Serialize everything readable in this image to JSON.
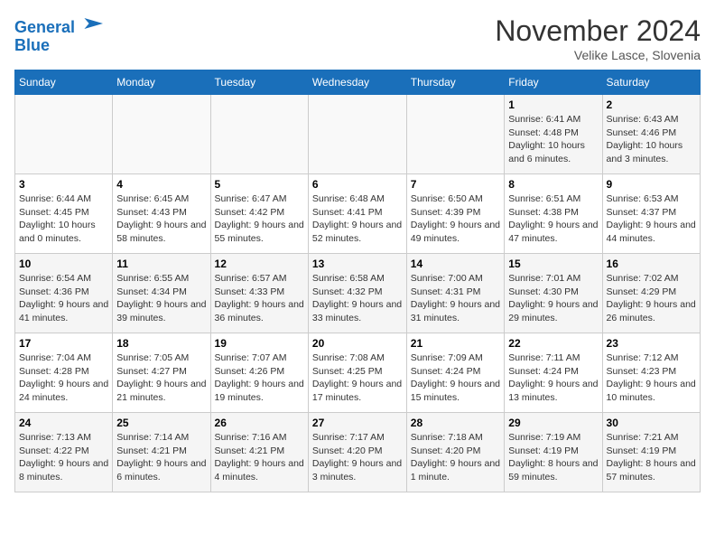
{
  "header": {
    "logo_line1": "General",
    "logo_line2": "Blue",
    "month_title": "November 2024",
    "location": "Velike Lasce, Slovenia"
  },
  "days_of_week": [
    "Sunday",
    "Monday",
    "Tuesday",
    "Wednesday",
    "Thursday",
    "Friday",
    "Saturday"
  ],
  "weeks": [
    [
      {
        "day": "",
        "info": ""
      },
      {
        "day": "",
        "info": ""
      },
      {
        "day": "",
        "info": ""
      },
      {
        "day": "",
        "info": ""
      },
      {
        "day": "",
        "info": ""
      },
      {
        "day": "1",
        "info": "Sunrise: 6:41 AM\nSunset: 4:48 PM\nDaylight: 10 hours and 6 minutes."
      },
      {
        "day": "2",
        "info": "Sunrise: 6:43 AM\nSunset: 4:46 PM\nDaylight: 10 hours and 3 minutes."
      }
    ],
    [
      {
        "day": "3",
        "info": "Sunrise: 6:44 AM\nSunset: 4:45 PM\nDaylight: 10 hours and 0 minutes."
      },
      {
        "day": "4",
        "info": "Sunrise: 6:45 AM\nSunset: 4:43 PM\nDaylight: 9 hours and 58 minutes."
      },
      {
        "day": "5",
        "info": "Sunrise: 6:47 AM\nSunset: 4:42 PM\nDaylight: 9 hours and 55 minutes."
      },
      {
        "day": "6",
        "info": "Sunrise: 6:48 AM\nSunset: 4:41 PM\nDaylight: 9 hours and 52 minutes."
      },
      {
        "day": "7",
        "info": "Sunrise: 6:50 AM\nSunset: 4:39 PM\nDaylight: 9 hours and 49 minutes."
      },
      {
        "day": "8",
        "info": "Sunrise: 6:51 AM\nSunset: 4:38 PM\nDaylight: 9 hours and 47 minutes."
      },
      {
        "day": "9",
        "info": "Sunrise: 6:53 AM\nSunset: 4:37 PM\nDaylight: 9 hours and 44 minutes."
      }
    ],
    [
      {
        "day": "10",
        "info": "Sunrise: 6:54 AM\nSunset: 4:36 PM\nDaylight: 9 hours and 41 minutes."
      },
      {
        "day": "11",
        "info": "Sunrise: 6:55 AM\nSunset: 4:34 PM\nDaylight: 9 hours and 39 minutes."
      },
      {
        "day": "12",
        "info": "Sunrise: 6:57 AM\nSunset: 4:33 PM\nDaylight: 9 hours and 36 minutes."
      },
      {
        "day": "13",
        "info": "Sunrise: 6:58 AM\nSunset: 4:32 PM\nDaylight: 9 hours and 33 minutes."
      },
      {
        "day": "14",
        "info": "Sunrise: 7:00 AM\nSunset: 4:31 PM\nDaylight: 9 hours and 31 minutes."
      },
      {
        "day": "15",
        "info": "Sunrise: 7:01 AM\nSunset: 4:30 PM\nDaylight: 9 hours and 29 minutes."
      },
      {
        "day": "16",
        "info": "Sunrise: 7:02 AM\nSunset: 4:29 PM\nDaylight: 9 hours and 26 minutes."
      }
    ],
    [
      {
        "day": "17",
        "info": "Sunrise: 7:04 AM\nSunset: 4:28 PM\nDaylight: 9 hours and 24 minutes."
      },
      {
        "day": "18",
        "info": "Sunrise: 7:05 AM\nSunset: 4:27 PM\nDaylight: 9 hours and 21 minutes."
      },
      {
        "day": "19",
        "info": "Sunrise: 7:07 AM\nSunset: 4:26 PM\nDaylight: 9 hours and 19 minutes."
      },
      {
        "day": "20",
        "info": "Sunrise: 7:08 AM\nSunset: 4:25 PM\nDaylight: 9 hours and 17 minutes."
      },
      {
        "day": "21",
        "info": "Sunrise: 7:09 AM\nSunset: 4:24 PM\nDaylight: 9 hours and 15 minutes."
      },
      {
        "day": "22",
        "info": "Sunrise: 7:11 AM\nSunset: 4:24 PM\nDaylight: 9 hours and 13 minutes."
      },
      {
        "day": "23",
        "info": "Sunrise: 7:12 AM\nSunset: 4:23 PM\nDaylight: 9 hours and 10 minutes."
      }
    ],
    [
      {
        "day": "24",
        "info": "Sunrise: 7:13 AM\nSunset: 4:22 PM\nDaylight: 9 hours and 8 minutes."
      },
      {
        "day": "25",
        "info": "Sunrise: 7:14 AM\nSunset: 4:21 PM\nDaylight: 9 hours and 6 minutes."
      },
      {
        "day": "26",
        "info": "Sunrise: 7:16 AM\nSunset: 4:21 PM\nDaylight: 9 hours and 4 minutes."
      },
      {
        "day": "27",
        "info": "Sunrise: 7:17 AM\nSunset: 4:20 PM\nDaylight: 9 hours and 3 minutes."
      },
      {
        "day": "28",
        "info": "Sunrise: 7:18 AM\nSunset: 4:20 PM\nDaylight: 9 hours and 1 minute."
      },
      {
        "day": "29",
        "info": "Sunrise: 7:19 AM\nSunset: 4:19 PM\nDaylight: 8 hours and 59 minutes."
      },
      {
        "day": "30",
        "info": "Sunrise: 7:21 AM\nSunset: 4:19 PM\nDaylight: 8 hours and 57 minutes."
      }
    ]
  ]
}
